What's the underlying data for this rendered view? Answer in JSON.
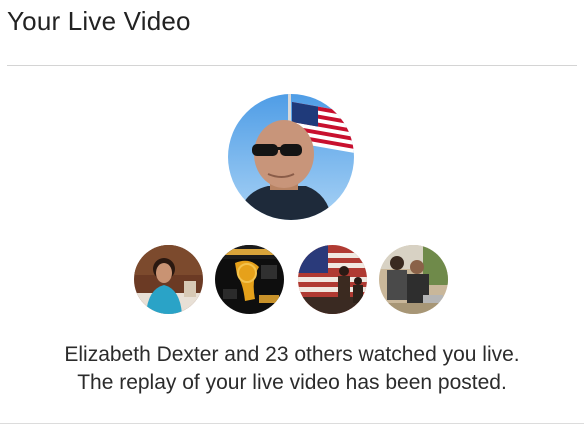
{
  "header": {
    "title": "Your Live Video"
  },
  "broadcaster": {
    "avatar_icon": "user-avatar-icon"
  },
  "viewers": [
    {
      "avatar_icon": "viewer-avatar-icon"
    },
    {
      "avatar_icon": "viewer-avatar-icon"
    },
    {
      "avatar_icon": "viewer-avatar-icon"
    },
    {
      "avatar_icon": "viewer-avatar-icon"
    }
  ],
  "message": {
    "line1": "Elizabeth Dexter and 23 others watched you live.",
    "line2": "The replay of your live video has been posted."
  },
  "colors": {
    "text": "#2b2b2b",
    "divider": "#d4d4d4",
    "sky": "#7fbcf0"
  }
}
